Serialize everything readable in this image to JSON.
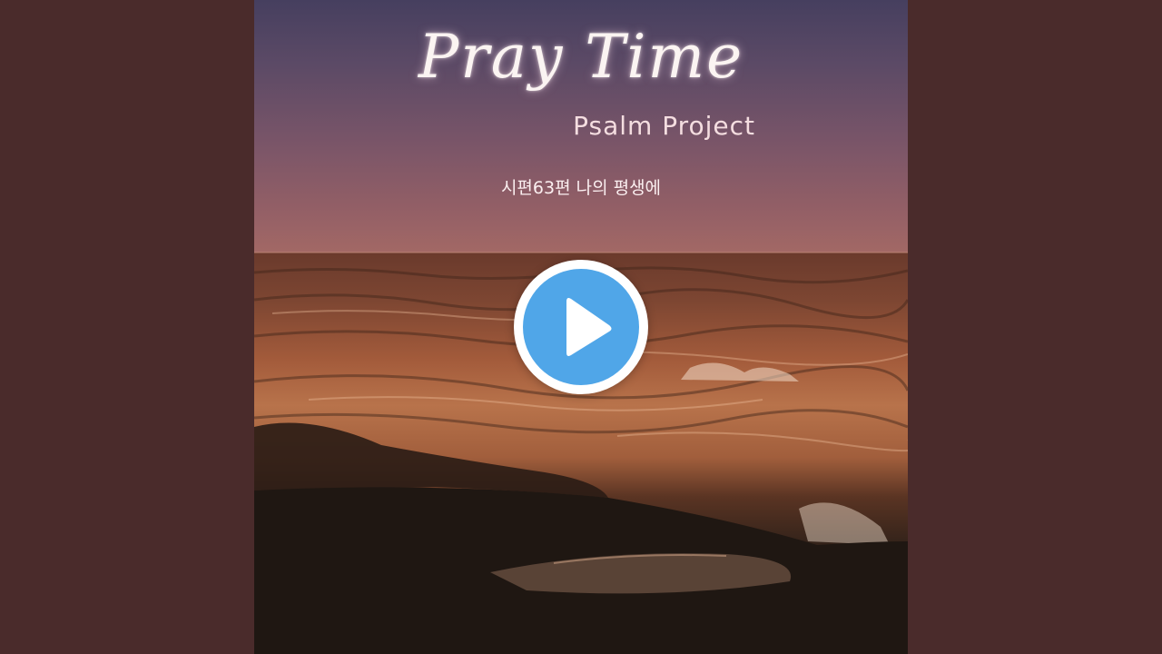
{
  "video": {
    "album_title": "Pray Time",
    "artist": "Psalm Project",
    "song_title": "시편63편 나의 평생에"
  },
  "controls": {
    "play_icon": "play-icon",
    "accent_color": "#50a6e8"
  },
  "colors": {
    "background": "#4a2b2b"
  }
}
